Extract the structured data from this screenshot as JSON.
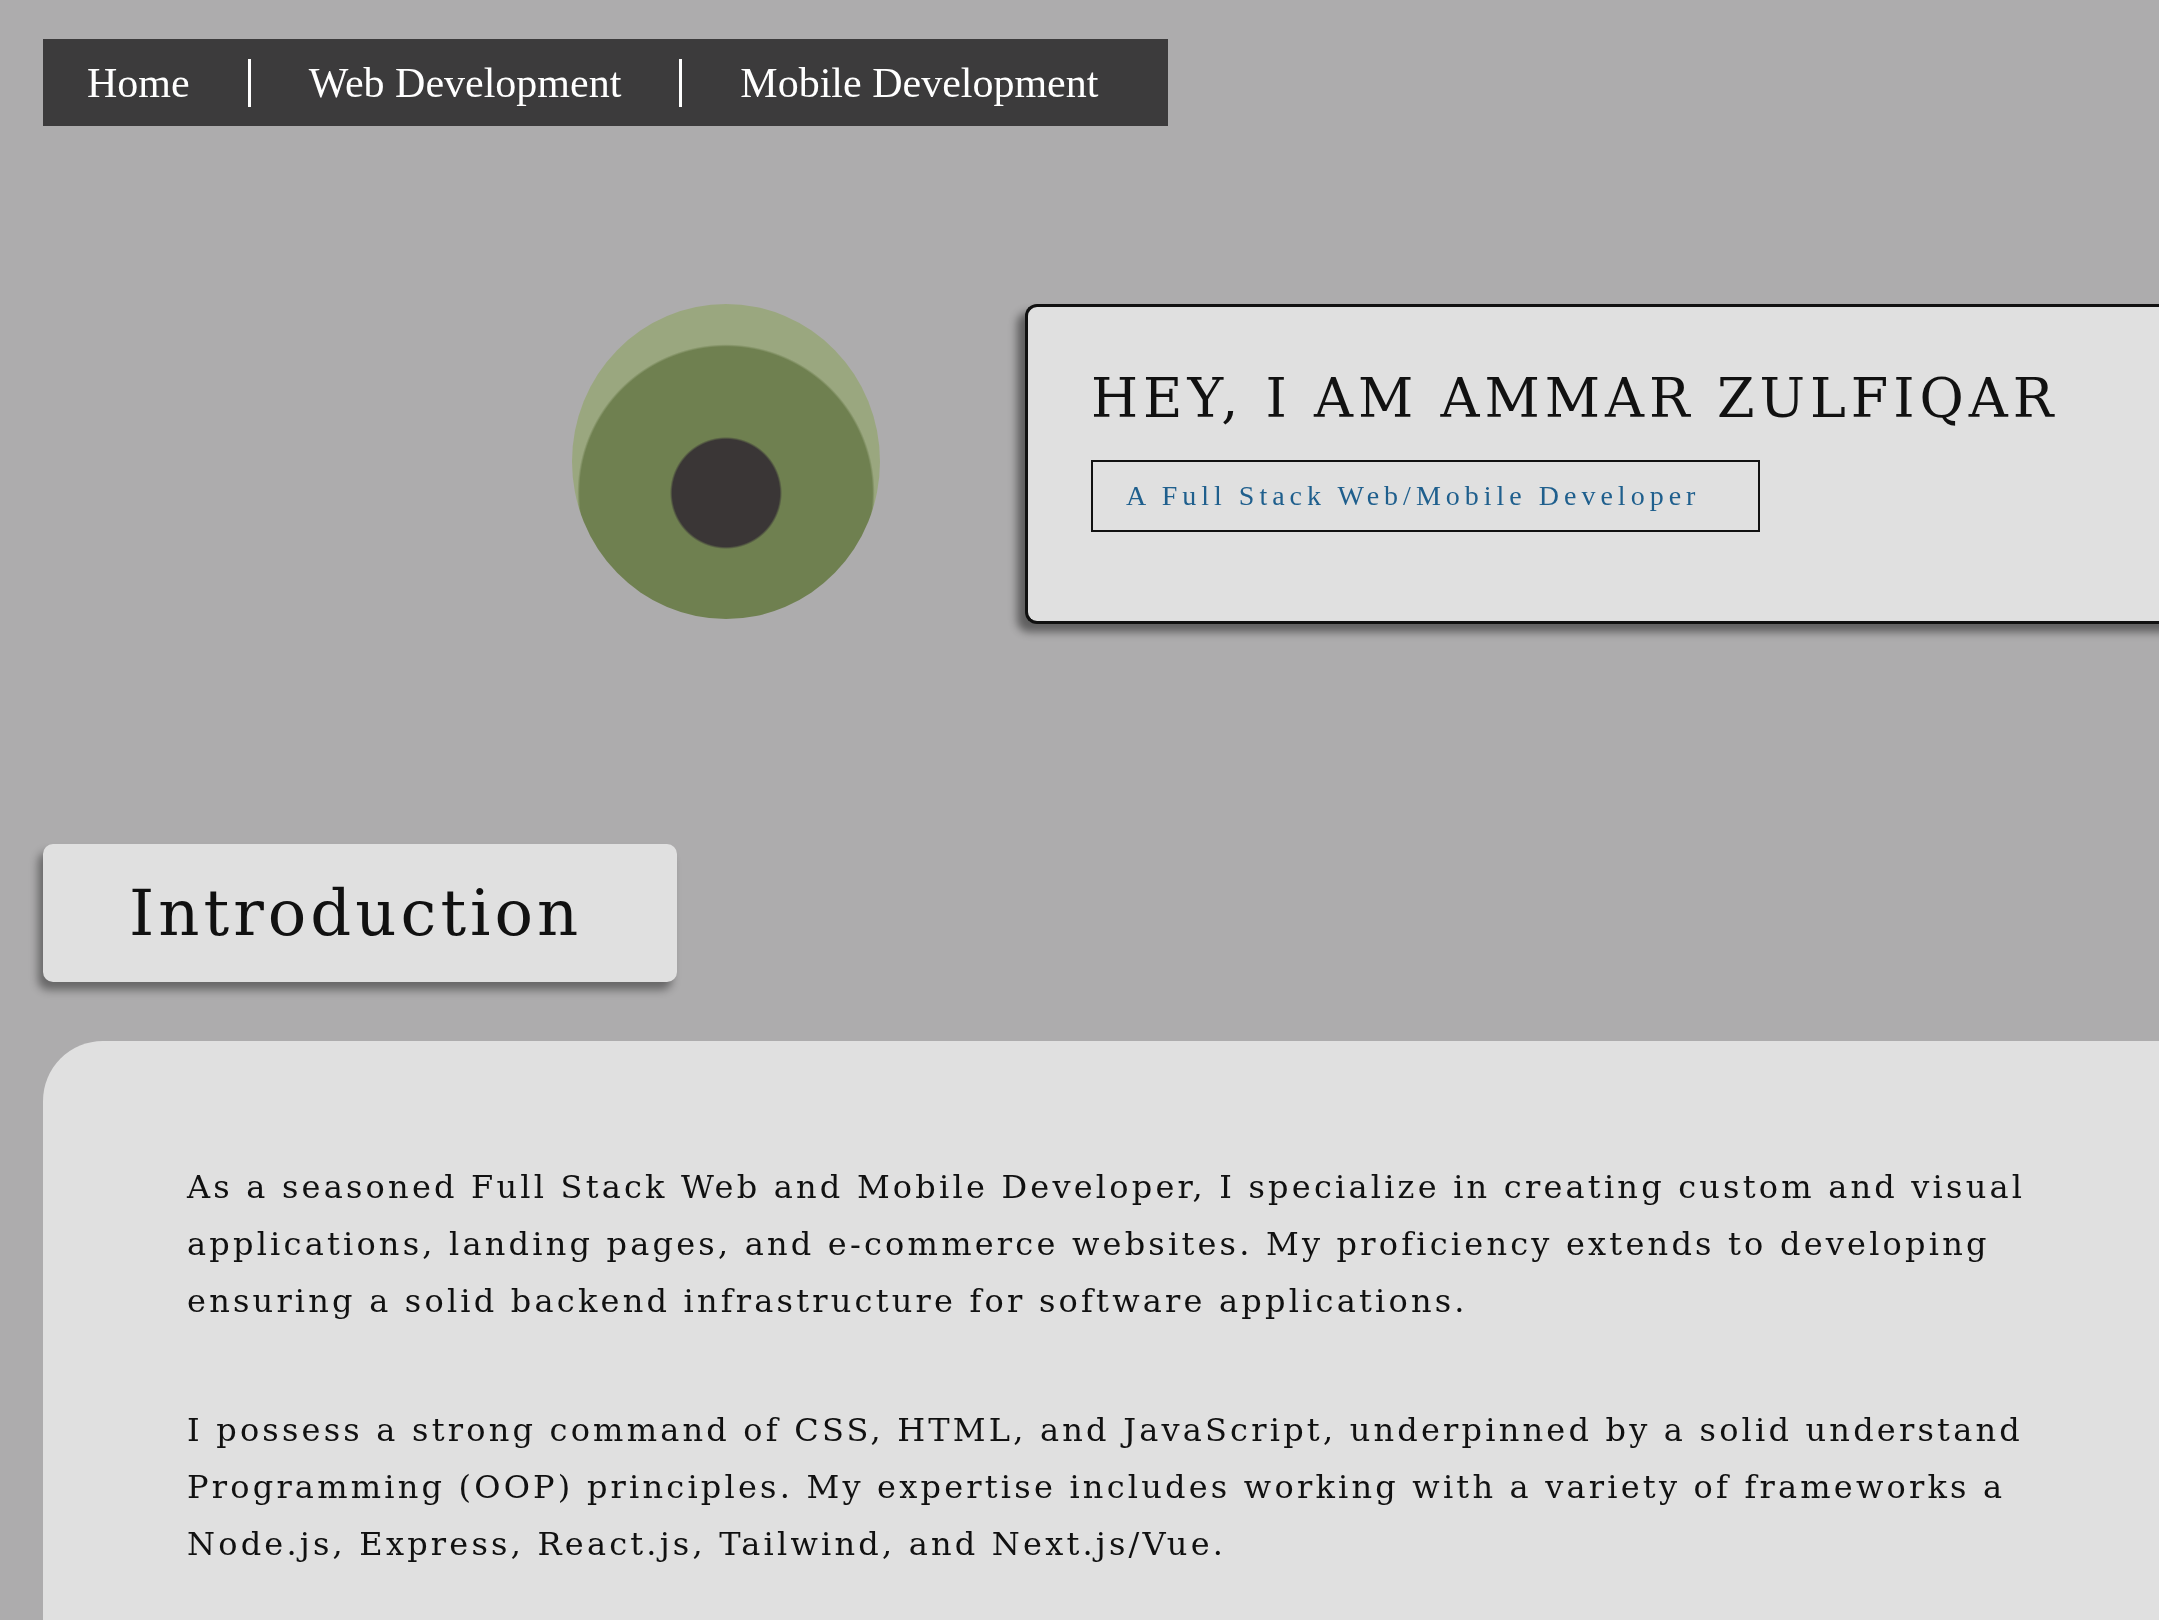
{
  "nav": {
    "items": [
      {
        "label": "Home"
      },
      {
        "label": "Web Development"
      },
      {
        "label": "Mobile Development"
      }
    ]
  },
  "hero": {
    "title": "HEY, I AM AMMAR ZULFIQAR",
    "subtitle": "A Full Stack Web/Mobile Developer"
  },
  "introduction": {
    "heading": "Introduction",
    "paragraphs": [
      {
        "lines": [
          "As a seasoned Full Stack Web and Mobile Developer, I specialize in creating custom and visual",
          "applications, landing pages, and e-commerce websites. My proficiency extends to developing",
          "ensuring a solid backend infrastructure for software applications."
        ]
      },
      {
        "lines": [
          "I possess a strong command of CSS, HTML, and JavaScript, underpinned by a solid understand",
          "Programming (OOP) principles. My expertise includes working with a variety of frameworks a",
          "Node.js, Express, React.js, Tailwind, and Next.js/Vue."
        ]
      }
    ]
  }
}
